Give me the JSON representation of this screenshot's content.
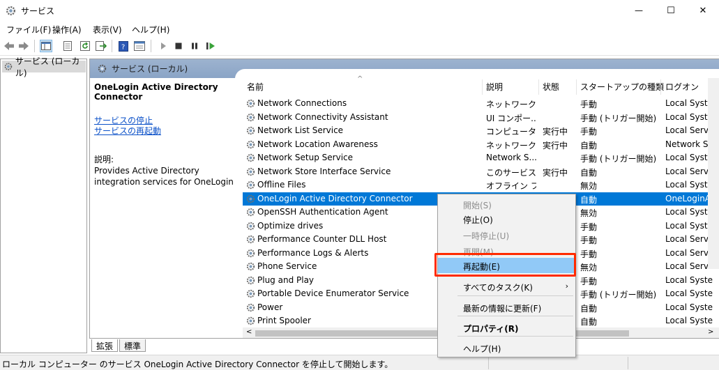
{
  "window": {
    "title": "サービス",
    "min_glyph": "—",
    "max_glyph": "☐",
    "close_glyph": "✕"
  },
  "menu": [
    "ファイル(F)",
    "操作(A)",
    "表示(V)",
    "ヘルプ(H)"
  ],
  "tree": {
    "node_label": "サービス (ローカル)"
  },
  "main_header": {
    "title": "サービス (ローカル)"
  },
  "description": {
    "service_name": "OneLogin Active Directory Connector",
    "link_stop": "サービスの停止",
    "link_restart": "サービスの再起動",
    "label": "説明:",
    "body": "Provides Active Directory integration services for OneLogin"
  },
  "columns": [
    "名前",
    "説明",
    "状態",
    "スタートアップの種類",
    "ログオン"
  ],
  "rows": [
    {
      "name": "Network Connections",
      "desc": "ネットワーク...",
      "status": "",
      "startup": "手動",
      "logon": "Local Syste"
    },
    {
      "name": "Network Connectivity Assistant",
      "desc": "UI コンポー...",
      "status": "",
      "startup": "手動 (トリガー開始)",
      "logon": "Local Syste"
    },
    {
      "name": "Network List Service",
      "desc": "コンピュータ...",
      "status": "実行中",
      "startup": "手動",
      "logon": "Local Servi"
    },
    {
      "name": "Network Location Awareness",
      "desc": "ネットワーク...",
      "status": "実行中",
      "startup": "自動",
      "logon": "Network Se"
    },
    {
      "name": "Network Setup Service",
      "desc": "Network S...",
      "status": "",
      "startup": "手動 (トリガー開始)",
      "logon": "Local Syste"
    },
    {
      "name": "Network Store Interface Service",
      "desc": "このサービス...",
      "status": "実行中",
      "startup": "自動",
      "logon": "Local Servi"
    },
    {
      "name": "Offline Files",
      "desc": "オフライン フ...",
      "status": "",
      "startup": "無効",
      "logon": "Local Syste"
    },
    {
      "name": "OneLogin Active Directory Connector",
      "desc": "",
      "status": "",
      "startup": "自動",
      "logon": "OneLoginA"
    },
    {
      "name": "OpenSSH Authentication Agent",
      "desc": "",
      "status": "",
      "startup": "無効",
      "logon": "Local Syste"
    },
    {
      "name": "Optimize drives",
      "desc": "",
      "status": "",
      "startup": "手動",
      "logon": "Local Syste"
    },
    {
      "name": "Performance Counter DLL Host",
      "desc": "",
      "status": "",
      "startup": "手動",
      "logon": "Local Servi"
    },
    {
      "name": "Performance Logs & Alerts",
      "desc": "",
      "status": "",
      "startup": "手動",
      "logon": "Local Servi"
    },
    {
      "name": "Phone Service",
      "desc": "",
      "status": "",
      "startup": "無効",
      "logon": "Local Servi"
    },
    {
      "name": "Plug and Play",
      "desc": "",
      "status": "",
      "startup": "手動",
      "logon": "Local Syste"
    },
    {
      "name": "Portable Device Enumerator Service",
      "desc": "",
      "status": "",
      "startup": "手動 (トリガー開始)",
      "logon": "Local Syste"
    },
    {
      "name": "Power",
      "desc": "",
      "status": "",
      "startup": "自動",
      "logon": "Local Syste"
    },
    {
      "name": "Print Spooler",
      "desc": "",
      "status": "",
      "startup": "自動",
      "logon": "Local Syste"
    }
  ],
  "selected_row": "OneLogin Active Directory Connector",
  "context_menu": {
    "items": [
      {
        "label": "開始(S)",
        "state": "disabled"
      },
      {
        "label": "停止(O)",
        "state": "enabled"
      },
      {
        "label": "一時停止(U)",
        "state": "disabled"
      },
      {
        "label": "再開(M)",
        "state": "disabled"
      },
      {
        "label": "再起動(E)",
        "state": "highlighted"
      },
      {
        "label": "すべてのタスク(K)",
        "state": "submenu"
      },
      {
        "label": "最新の情報に更新(F)",
        "state": "enabled"
      },
      {
        "label": "プロパティ(R)",
        "state": "bold"
      },
      {
        "label": "ヘルプ(H)",
        "state": "enabled"
      }
    ],
    "submenu_arrow": "›"
  },
  "tabs": [
    "拡張",
    "標準"
  ],
  "status_bar": "ローカル コンピューター のサービス OneLogin Active Directory Connector を停止して開始します。",
  "colors": {
    "selection": "#0078d7",
    "menu_highlight": "#91c9f7",
    "annotation_box": "#ff2a00",
    "header_band": "#9db3cf",
    "link": "#0a50c8"
  }
}
